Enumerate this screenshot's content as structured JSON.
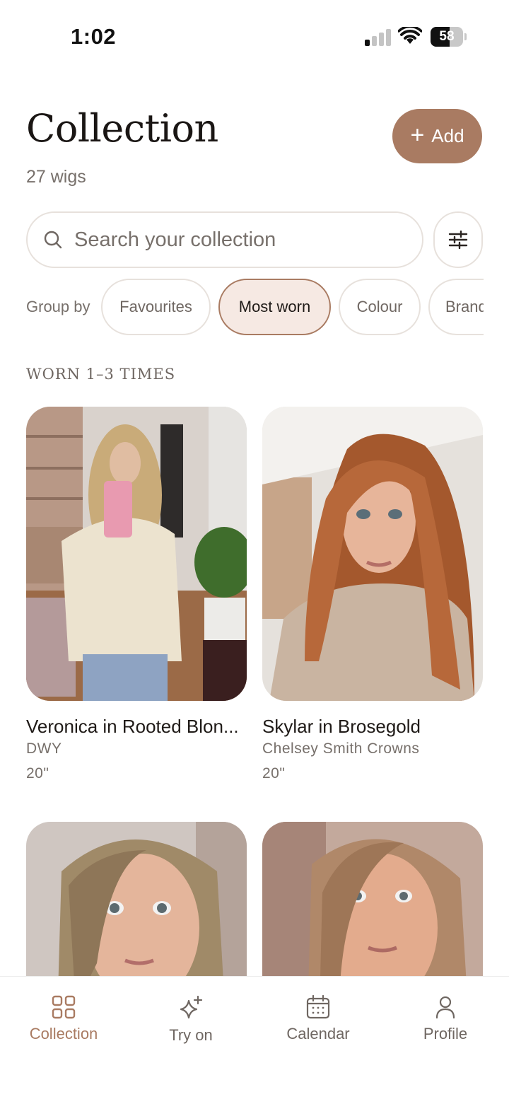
{
  "status_bar": {
    "time": "1:02",
    "battery": "58",
    "battery_level": 0.58
  },
  "header": {
    "title": "Collection",
    "count_text": "27 wigs",
    "add_label": "Add"
  },
  "search": {
    "placeholder": "Search your collection",
    "value": ""
  },
  "group_by": {
    "label": "Group by",
    "options": [
      "Favourites",
      "Most worn",
      "Colour",
      "Brand"
    ],
    "selected": "Most worn"
  },
  "section": {
    "heading": "WORN 1–3 TIMES"
  },
  "wigs": [
    {
      "title": "Veronica in Rooted Blon...",
      "brand": "DWY",
      "length": "20\""
    },
    {
      "title": "Skylar in Brosegold",
      "brand": "Chelsey Smith Crowns",
      "length": "20\""
    },
    {
      "title": "",
      "brand": "",
      "length": ""
    },
    {
      "title": "",
      "brand": "",
      "length": ""
    }
  ],
  "tabs": [
    {
      "label": "Collection",
      "icon": "grid-icon",
      "active": true
    },
    {
      "label": "Try on",
      "icon": "sparkle-icon",
      "active": false
    },
    {
      "label": "Calendar",
      "icon": "calendar-icon",
      "active": false
    },
    {
      "label": "Profile",
      "icon": "person-icon",
      "active": false
    }
  ],
  "colors": {
    "accent": "#a97b62",
    "chip_active_bg": "#f6e9e3",
    "text_primary": "#1f1a17",
    "text_secondary": "#77706b",
    "border": "#e7e1dc"
  }
}
